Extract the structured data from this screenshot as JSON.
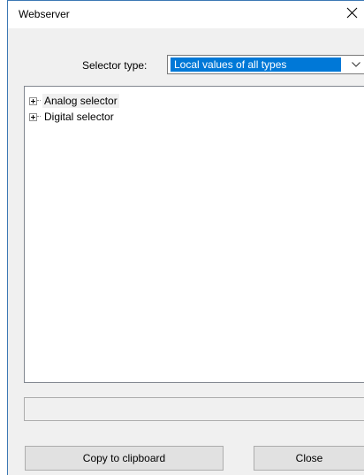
{
  "window": {
    "title": "Webserver"
  },
  "title_bar": {
    "close_icon": "close-x-icon"
  },
  "selector": {
    "label": "Selector type:",
    "value": "Local values of all types",
    "dropdown_icon": "chevron-down-icon"
  },
  "tree": {
    "items": [
      {
        "label": "Analog selector",
        "expanded": false,
        "selected": true
      },
      {
        "label": "Digital selector",
        "expanded": false,
        "selected": false
      }
    ],
    "expander_icon": "plus-box-icon"
  },
  "status": {
    "text": ""
  },
  "buttons": {
    "copy_label": "Copy to clipboard",
    "close_label": "Close"
  },
  "colors": {
    "accent": "#0078d7",
    "window_border": "#3c78b4",
    "face": "#f0f0f0"
  }
}
